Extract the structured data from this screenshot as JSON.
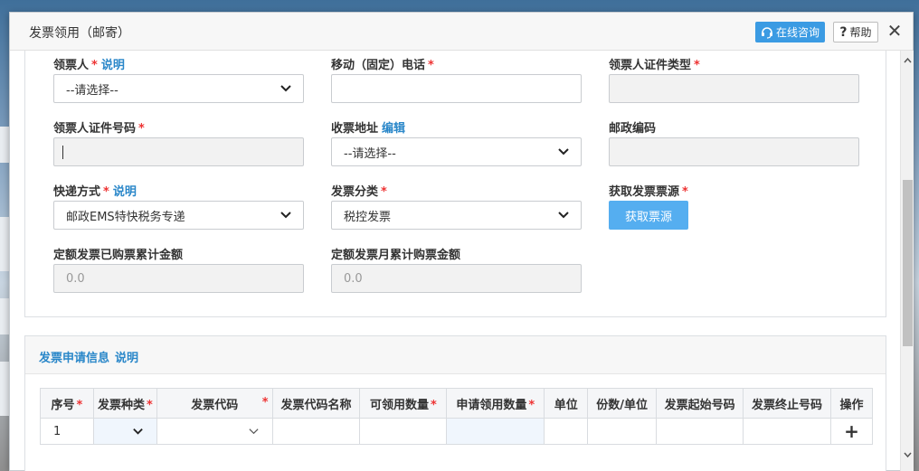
{
  "modal": {
    "title": "发票领用（邮寄）",
    "consult_label": "在线咨询",
    "help_label": "帮助",
    "help_mark": "?",
    "close_label": "✕"
  },
  "form": {
    "recipient": {
      "label": "领票人",
      "link": "说明",
      "value": "--请选择--"
    },
    "phone": {
      "label": "移动（固定）电话",
      "value": ""
    },
    "id_type": {
      "label": "领票人证件类型",
      "value": ""
    },
    "id_number": {
      "label": "领票人证件号码",
      "value": ""
    },
    "address": {
      "label": "收票地址",
      "link": "编辑",
      "value": "--请选择--"
    },
    "postcode": {
      "label": "邮政编码",
      "value": ""
    },
    "delivery": {
      "label": "快递方式",
      "link": "说明",
      "value": "邮政EMS特快税务专递"
    },
    "category": {
      "label": "发票分类",
      "value": "税控发票"
    },
    "source": {
      "label": "获取发票票源",
      "button": "获取票源"
    },
    "quota_total": {
      "label": "定额发票已购票累计金额",
      "value": "0.0"
    },
    "quota_month": {
      "label": "定额发票月累计购票金额",
      "value": "0.0"
    },
    "required_mark": "*"
  },
  "apply": {
    "title": "发票申请信息",
    "link": "说明",
    "columns": [
      "序号",
      "发票种类",
      "发票代码",
      "发票代码名称",
      "可领用数量",
      "申请领用数量",
      "单位",
      "份数/单位",
      "发票起始号码",
      "发票终止号码",
      "操作"
    ],
    "rows": [
      {
        "index": "1",
        "add": "+"
      }
    ]
  },
  "colors": {
    "accent": "#3b9be3",
    "link": "#2a87c9",
    "required": "#e33333",
    "button": "#55aef0"
  }
}
